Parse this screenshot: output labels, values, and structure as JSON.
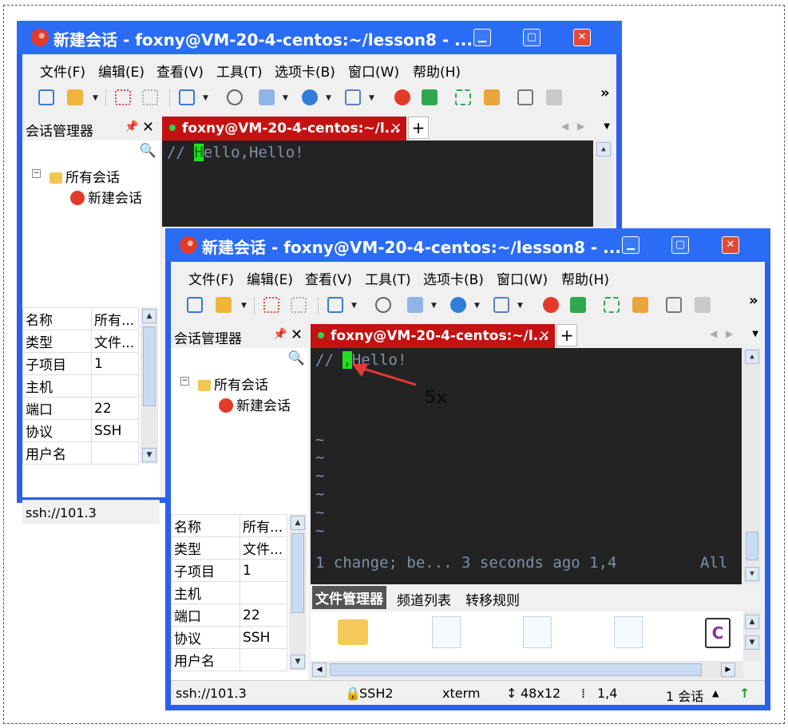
{
  "window": {
    "title": "新建会话 - foxny@VM-20-4-centos:~/lesson8 - ...",
    "menu": [
      "文件(F)",
      "编辑(E)",
      "查看(V)",
      "工具(T)",
      "选项卡(B)",
      "窗口(W)",
      "帮助(H)"
    ],
    "more_glyph": "»"
  },
  "sidebar": {
    "title": "会话管理器",
    "tree_root": "所有会话",
    "tree_child": "新建会话"
  },
  "properties": [
    {
      "key": "名称",
      "value": "所有..."
    },
    {
      "key": "类型",
      "value": "文件..."
    },
    {
      "key": "子项目",
      "value": "1"
    },
    {
      "key": "主机",
      "value": ""
    },
    {
      "key": "端口",
      "value": "22"
    },
    {
      "key": "协议",
      "value": "SSH"
    },
    {
      "key": "用户名",
      "value": ""
    }
  ],
  "tab": {
    "label": "foxny@VM-20-4-centos:~/l...",
    "close": "×",
    "plus": "+"
  },
  "terminal_before": {
    "line1_prefix": "// ",
    "line1_cursor": "H",
    "line1_rest": "ello,Hello!"
  },
  "terminal_after": {
    "line1_prefix": "// ",
    "line1_cursor": ",",
    "line1_rest": "Hello!",
    "tilde": "~",
    "status_left": "1 change; be... 3 seconds ago 1,4",
    "status_right": "All"
  },
  "annotation": {
    "label": "5x",
    "color": "#e53935"
  },
  "file_manager": {
    "tabs": [
      "文件管理器",
      "频道列表",
      "转移规则"
    ],
    "c_icon_letter": "C"
  },
  "statusbar": {
    "host": "ssh://101.3",
    "protocol": "SSH2",
    "term": "xterm",
    "size": "48x12",
    "pos": "1,4",
    "sessions": "1 会话"
  },
  "colors": {
    "titlebar": "#2a6cf5",
    "active_tab": "#c41212",
    "terminal_bg": "#232323",
    "cursor": "#20e020"
  }
}
